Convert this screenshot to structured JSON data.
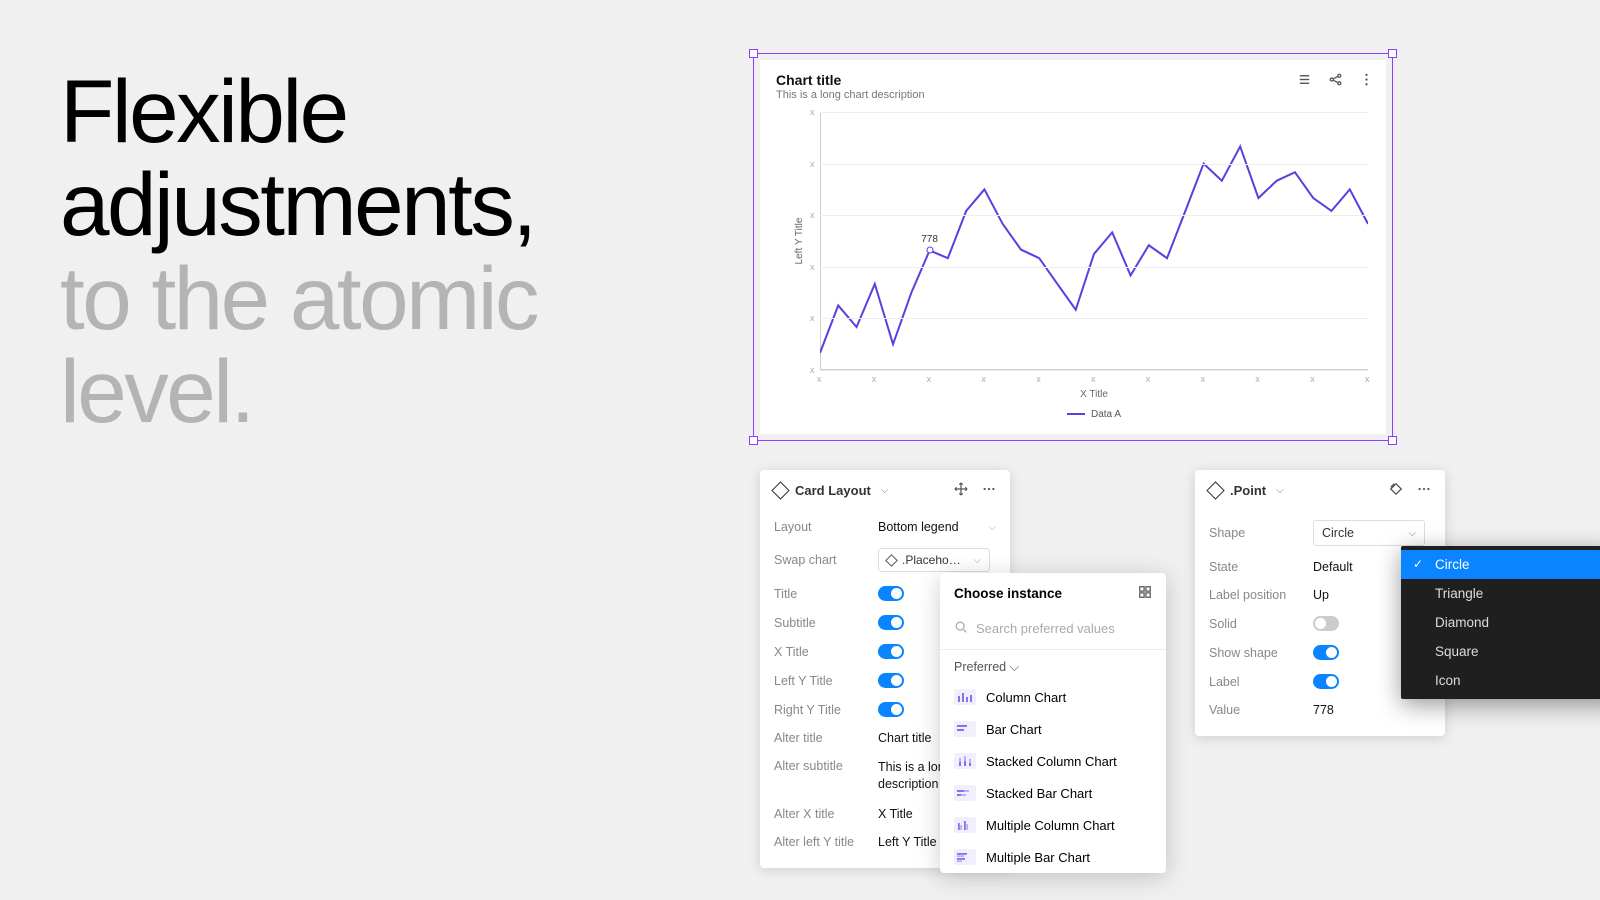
{
  "headline": {
    "line1": "Flexible",
    "line2": "adjustments,",
    "line3": "to the atomic",
    "line4": "level."
  },
  "chart": {
    "title": "Chart title",
    "description": "This is a long chart description",
    "x_title": "X Title",
    "left_y_title": "Left Y Title",
    "legend_series": "Data A",
    "point_label": "778"
  },
  "chart_data": {
    "type": "line",
    "title": "Chart title",
    "xlabel": "X Title",
    "ylabel": "Left Y Title",
    "series": [
      {
        "name": "Data A",
        "values": [
          540,
          650,
          600,
          700,
          560,
          680,
          778,
          760,
          870,
          920,
          840,
          780,
          760,
          700,
          640,
          770,
          820,
          720,
          790,
          760,
          870,
          980,
          940,
          1020,
          900,
          940,
          960,
          900,
          870,
          920,
          840
        ]
      }
    ],
    "highlight": {
      "index": 6,
      "value": 778
    },
    "ylim": [
      500,
      1100
    ]
  },
  "cardLayout": {
    "header": "Card Layout",
    "rows": {
      "layout": {
        "label": "Layout",
        "value": "Bottom legend"
      },
      "swap": {
        "label": "Swap chart",
        "value": ".Placehol…"
      },
      "title": {
        "label": "Title"
      },
      "subtitle": {
        "label": "Subtitle"
      },
      "xtitle": {
        "label": "X Title"
      },
      "lytitle": {
        "label": "Left Y Title"
      },
      "rytitle": {
        "label": "Right Y Title"
      },
      "alterTitle": {
        "label": "Alter title",
        "value": "Chart title"
      },
      "alterSubtitle": {
        "label": "Alter subtitle",
        "value": "This is a long chart description"
      },
      "alterX": {
        "label": "Alter X title",
        "value": "X Title"
      },
      "alterLY": {
        "label": "Alter left Y title",
        "value": "Left Y Title"
      }
    }
  },
  "picker": {
    "header": "Choose instance",
    "search_placeholder": "Search preferred values",
    "section": "Preferred",
    "items": [
      "Column Chart",
      "Bar Chart",
      "Stacked Column Chart",
      "Stacked Bar Chart",
      "Multiple Column Chart",
      "Multiple Bar Chart"
    ]
  },
  "point": {
    "header": ".Point",
    "rows": {
      "shape": {
        "label": "Shape",
        "value": "Circle"
      },
      "state": {
        "label": "State",
        "value": "Default"
      },
      "labelPos": {
        "label": "Label position",
        "value": "Up"
      },
      "solid": {
        "label": "Solid"
      },
      "showShape": {
        "label": "Show shape"
      },
      "label": {
        "label": "Label"
      },
      "value": {
        "label": "Value",
        "value": "778"
      }
    }
  },
  "dropdown": {
    "items": [
      "Circle",
      "Triangle",
      "Diamond",
      "Square",
      "Icon"
    ],
    "selected": "Circle"
  }
}
